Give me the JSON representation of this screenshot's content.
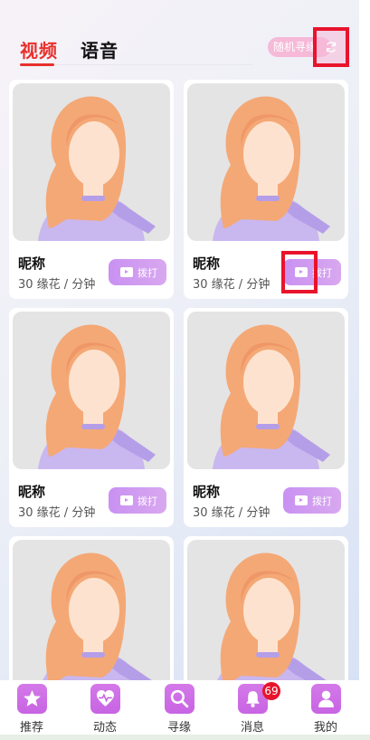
{
  "tabs": {
    "video": "视频",
    "voice": "语音"
  },
  "random_button": "随机寻缘",
  "cards": [
    {
      "name": "昵称",
      "price": "30 缘花 / 分钟",
      "call": "拨打"
    },
    {
      "name": "昵称",
      "price": "30 缘花 / 分钟",
      "call": "拨打"
    },
    {
      "name": "昵称",
      "price": "30 缘花 / 分钟",
      "call": "拨打"
    },
    {
      "name": "昵称",
      "price": "30 缘花 / 分钟",
      "call": "拨打"
    }
  ],
  "nav": {
    "recommend": "推荐",
    "moments": "动态",
    "search": "寻缘",
    "messages": "消息",
    "mine": "我的",
    "badge": "69"
  },
  "colors": {
    "accent": "#e8302c",
    "brand": "#c864e3",
    "highlight": "#e8142c"
  }
}
